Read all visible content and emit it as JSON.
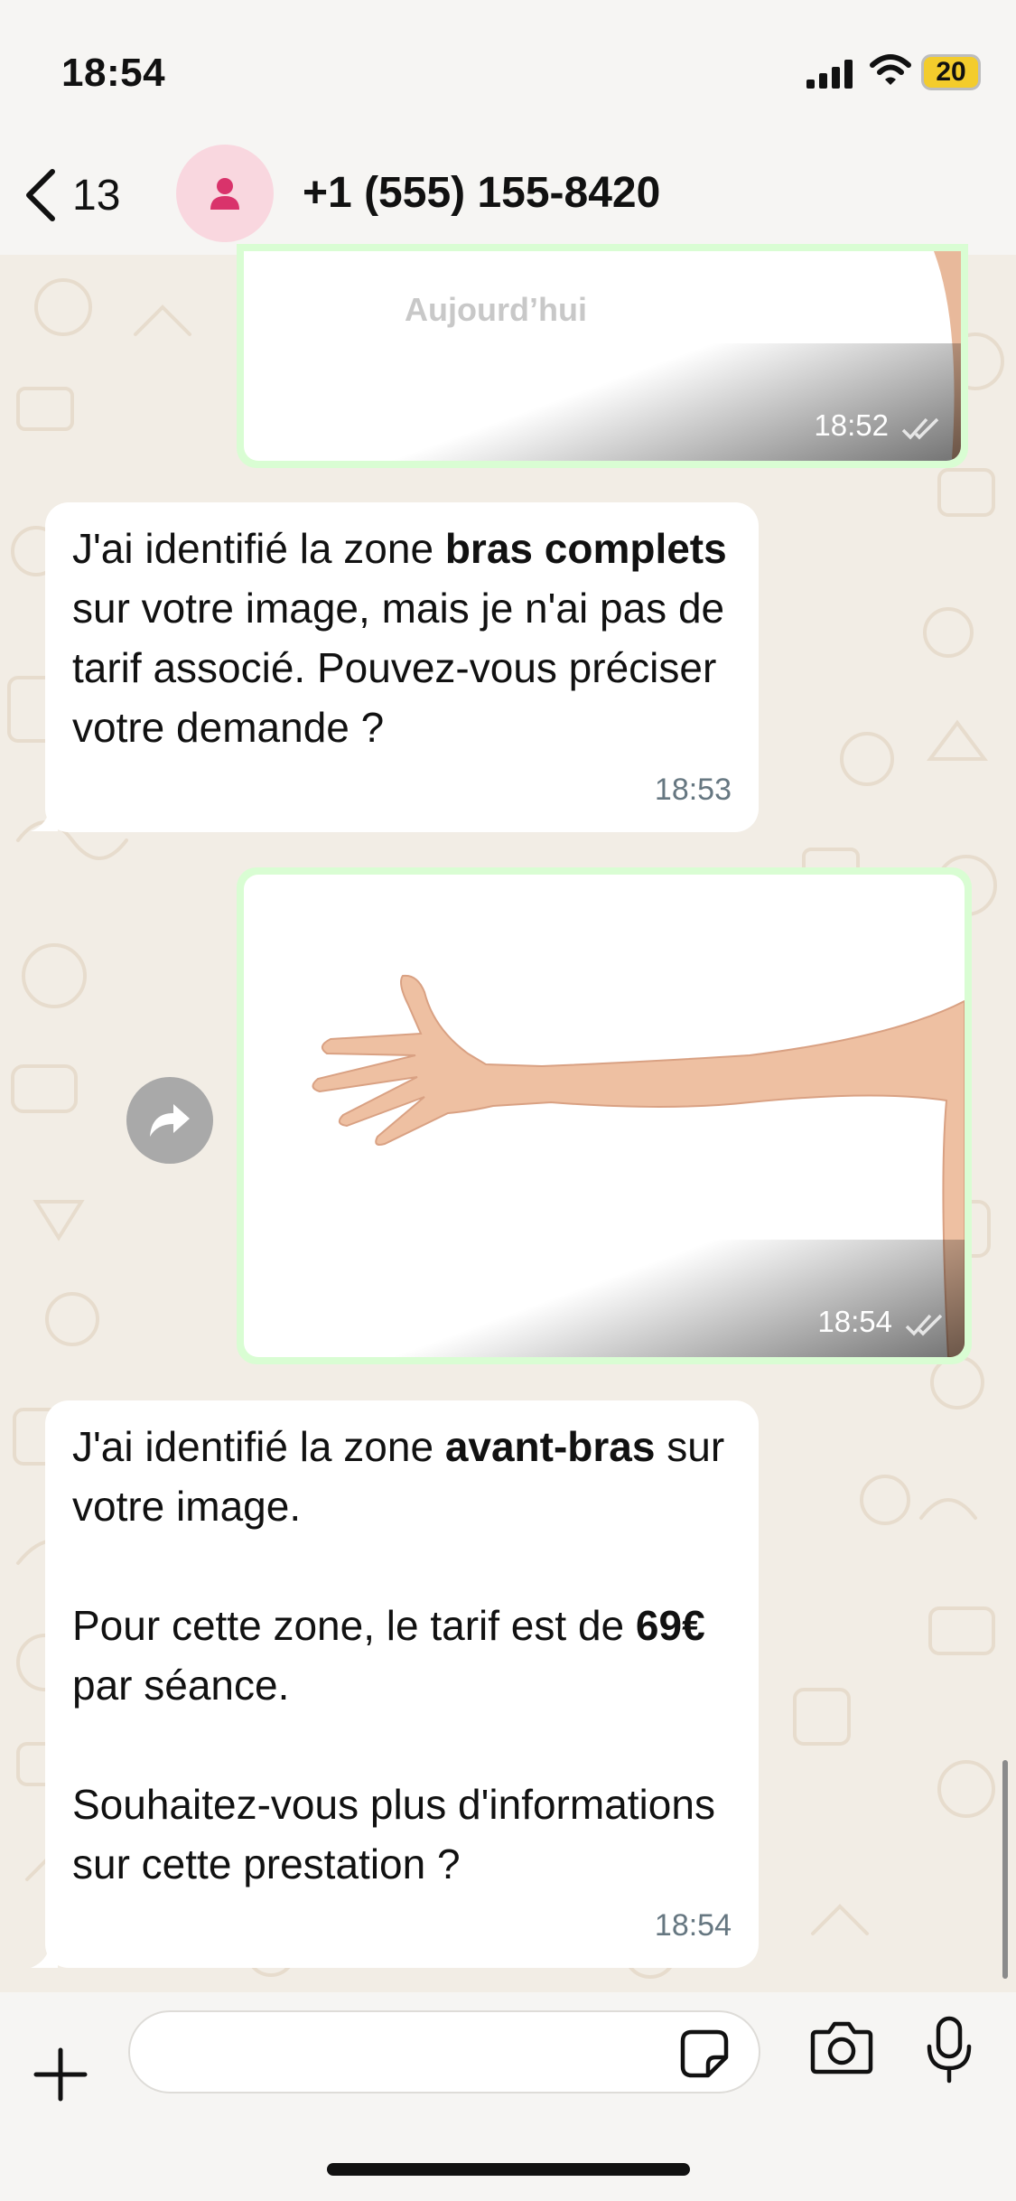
{
  "status_bar": {
    "time": "18:54",
    "battery": "20"
  },
  "header": {
    "back_count": "13",
    "contact": "+1 (555) 155-8420"
  },
  "date_chip": "Aujourd’hui",
  "messages": {
    "image1": {
      "time": "18:52"
    },
    "text1": {
      "p1_a": "J'ai identifié la zone ",
      "p1_b": "bras complets",
      "p1_c": " sur votre image, mais je n'ai pas de tarif associé. Pouvez-vous préciser votre demande ?",
      "time": "18:53"
    },
    "image2": {
      "time": "18:54"
    },
    "text2": {
      "p1_a": "J'ai identifié la zone ",
      "p1_b": "avant-bras",
      "p1_c": " sur votre image.",
      "p2_a": "Pour cette zone, le tarif est de ",
      "p2_b": "69€",
      "p2_c": " par séance.",
      "p3": "Souhaitez-vous plus d'informations sur cette prestation ?",
      "time": "18:54"
    }
  },
  "input": {
    "placeholder": ""
  },
  "icons": {
    "back": "chevron-left-icon",
    "avatar": "person-icon",
    "forward": "forward-arrow-icon",
    "plus": "plus-icon",
    "sticker": "sticker-icon",
    "camera": "camera-icon",
    "mic": "microphone-icon",
    "read": "double-check-icon"
  },
  "colors": {
    "outgoing_bubble": "#d9fdd3",
    "incoming_bubble": "#ffffff",
    "avatar_bg": "#f9d7df",
    "avatar_icon": "#d9336b",
    "battery": "#f3cc2c"
  }
}
